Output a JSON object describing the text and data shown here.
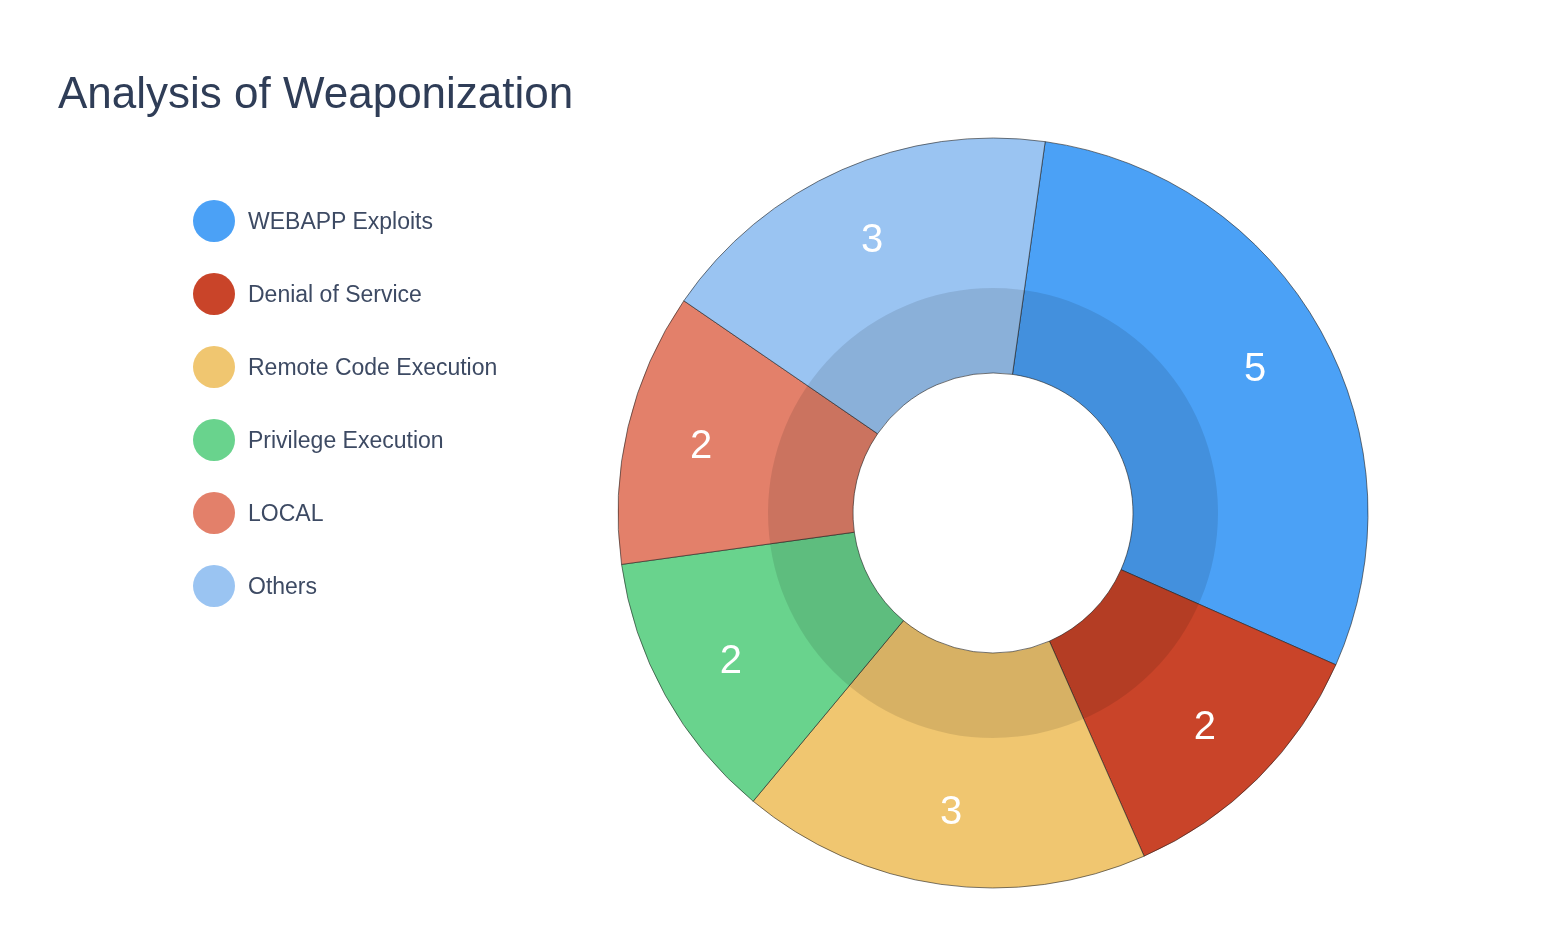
{
  "title": "Analysis of Weaponization",
  "chart_data": {
    "type": "donut",
    "categories": [
      "WEBAPP Exploits",
      "Denial of Service",
      "Remote Code Execution",
      "Privilege Execution",
      "LOCAL",
      "Others"
    ],
    "values": [
      5,
      2,
      3,
      2,
      2,
      3
    ],
    "colors": [
      "#4ba1f6",
      "#c94429",
      "#f0c670",
      "#69d38d",
      "#e3806a",
      "#9ac4f2"
    ],
    "data_labels": true
  }
}
